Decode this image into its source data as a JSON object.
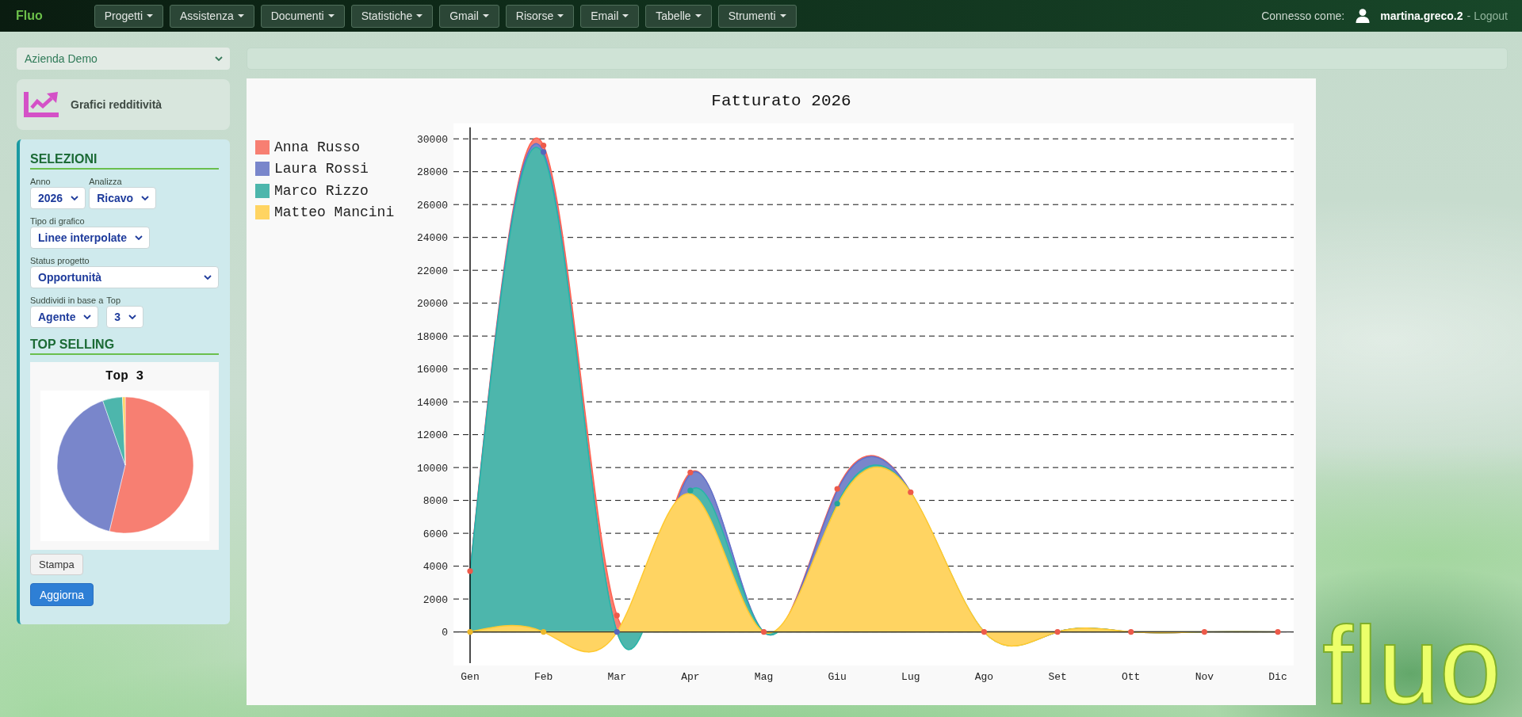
{
  "navbar": {
    "brand": "Fluo",
    "menus": [
      "Progetti",
      "Assistenza",
      "Documenti",
      "Statistiche",
      "Gmail",
      "Risorse",
      "Email",
      "Tabelle",
      "Strumenti"
    ],
    "user": {
      "label": "Connesso come:",
      "username": "martina.greco.2",
      "separator": "-",
      "logout": "Logout"
    }
  },
  "sidebar": {
    "company_select": {
      "value": "Azienda Demo"
    },
    "page_card": {
      "title": "Grafici redditività"
    },
    "selections": {
      "heading": "SELEZIONI",
      "rows": [
        [
          {
            "label": "Anno",
            "value": "2026",
            "kind": "inline"
          },
          {
            "label": "Analizza",
            "value": "Ricavo",
            "kind": "inline"
          }
        ],
        [
          {
            "label": "Tipo di grafico",
            "value": "Linee interpolate",
            "kind": "inline"
          }
        ],
        [
          {
            "label": "Status progetto",
            "value": "Opportunità",
            "kind": "block"
          }
        ],
        [
          {
            "label": "Suddividi in base a",
            "value": "Agente",
            "kind": "inline"
          },
          {
            "label": "Top",
            "value": "3",
            "kind": "inline"
          }
        ]
      ]
    },
    "top_selling": {
      "heading": "TOP SELLING",
      "chart_title": "Top 3"
    },
    "buttons": [
      {
        "label": "Stampa",
        "kind": "default"
      },
      {
        "label": "Aggiorna",
        "kind": "primary"
      }
    ]
  },
  "main": {
    "chart": {
      "chart_data": {
        "type": "area",
        "title": "Fatturato 2026",
        "stacked": true,
        "grid": true,
        "legend": "left",
        "categories": [
          "Gen",
          "Feb",
          "Mar",
          "Apr",
          "Mag",
          "Giu",
          "Lug",
          "Ago",
          "Set",
          "Ott",
          "Nov",
          "Dic"
        ],
        "series": [
          {
            "name": "Anna Russo",
            "color": "#f77f72",
            "values": [
              100,
              400,
              1000,
              100,
              0,
              100,
              0,
              0,
              0,
              0,
              0,
              0
            ]
          },
          {
            "name": "Laura Rossi",
            "color": "#7986cb",
            "values": [
              0,
              200,
              0,
              1000,
              0,
              800,
              0,
              0,
              0,
              0,
              0,
              0
            ]
          },
          {
            "name": "Marco Rizzo",
            "color": "#4db6ac",
            "values": [
              3600,
              29000,
              0,
              200,
              0,
              100,
              0,
              0,
              0,
              0,
              0,
              0
            ]
          },
          {
            "name": "Matteo Mancini",
            "color": "#ffd462",
            "values": [
              0,
              0,
              0,
              8400,
              0,
              7700,
              8500,
              0,
              0,
              0,
              0,
              0
            ]
          }
        ],
        "ylim": [
          -1900,
          30700
        ],
        "yticks": [
          0,
          2000,
          4000,
          6000,
          8000,
          10000,
          12000,
          14000,
          16000,
          18000,
          20000,
          22000,
          24000,
          26000,
          28000,
          30000
        ],
        "ref_lines": [
          {
            "axis": "x",
            "value": "Gen"
          }
        ]
      }
    }
  },
  "background_logo": {
    "text": "fluo"
  }
}
